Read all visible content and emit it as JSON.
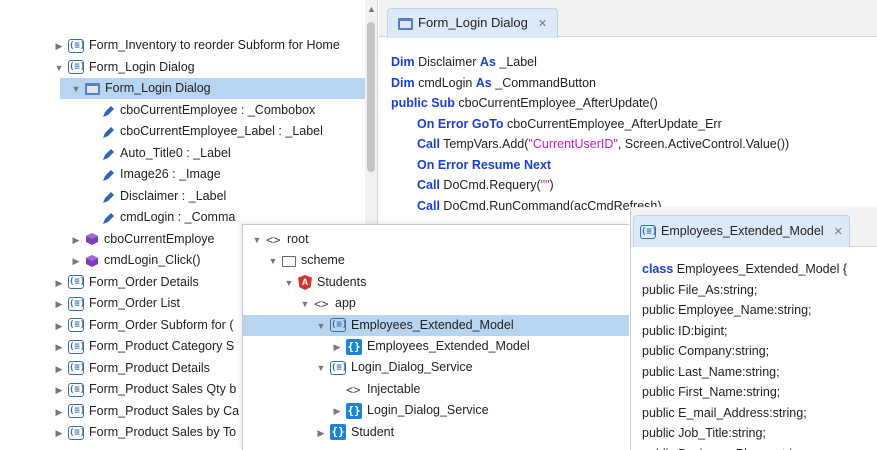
{
  "left_tree": {
    "rows": [
      {
        "label": "Form_Inventory to reorder Subform for Home",
        "icon": "module-icon",
        "expand": "▶",
        "level": 1
      },
      {
        "label": "Form_Login Dialog",
        "icon": "module-icon",
        "expand": "▼",
        "level": 1
      },
      {
        "label": "Form_Login Dialog",
        "icon": "form-icon",
        "expand": "▼",
        "level": 2,
        "selected": true
      },
      {
        "label": "cboCurrentEmployee : _Combobox",
        "icon": "field-icon",
        "expand": "",
        "level": 3
      },
      {
        "label": "cboCurrentEmployee_Label : _Label",
        "icon": "field-icon",
        "expand": "",
        "level": 3
      },
      {
        "label": "Auto_Title0 : _Label",
        "icon": "field-icon",
        "expand": "",
        "level": 3
      },
      {
        "label": "Image26 : _Image",
        "icon": "field-icon",
        "expand": "",
        "level": 3
      },
      {
        "label": "Disclaimer : _Label",
        "icon": "field-icon",
        "expand": "",
        "level": 3
      },
      {
        "label": "cmdLogin : _Comma",
        "icon": "field-icon",
        "expand": "",
        "level": 3
      },
      {
        "label": "cboCurrentEmploye",
        "icon": "method-icon",
        "expand": "▶",
        "level": 2
      },
      {
        "label": "cmdLogin_Click()",
        "icon": "method-icon",
        "expand": "▶",
        "level": 2
      },
      {
        "label": "Form_Order Details",
        "icon": "module-icon",
        "expand": "▶",
        "level": 1
      },
      {
        "label": "Form_Order List",
        "icon": "module-icon",
        "expand": "▶",
        "level": 1
      },
      {
        "label": "Form_Order Subform for (",
        "icon": "module-icon",
        "expand": "▶",
        "level": 1
      },
      {
        "label": "Form_Product Category S",
        "icon": "module-icon",
        "expand": "▶",
        "level": 1
      },
      {
        "label": "Form_Product Details",
        "icon": "module-icon",
        "expand": "▶",
        "level": 1
      },
      {
        "label": "Form_Product Sales Qty b",
        "icon": "module-icon",
        "expand": "▶",
        "level": 1
      },
      {
        "label": "Form_Product Sales by Ca",
        "icon": "module-icon",
        "expand": "▶",
        "level": 1
      },
      {
        "label": "Form_Product Sales by To",
        "icon": "module-icon",
        "expand": "▶",
        "level": 1
      }
    ]
  },
  "editor": {
    "tab_label": "Form_Login Dialog",
    "close_glyph": "✕",
    "lines": [
      {
        "indent": 0,
        "parts": [
          {
            "t": "Dim",
            "c": "kw"
          },
          {
            "t": " Disclaimer ",
            "c": "pl"
          },
          {
            "t": "As",
            "c": "kw"
          },
          {
            "t": " _Label",
            "c": "pl"
          }
        ]
      },
      {
        "indent": 0,
        "parts": [
          {
            "t": "Dim",
            "c": "kw"
          },
          {
            "t": " cmdLogin ",
            "c": "pl"
          },
          {
            "t": "As",
            "c": "kw"
          },
          {
            "t": " _CommandButton",
            "c": "pl"
          }
        ]
      },
      {
        "indent": 0,
        "parts": [
          {
            "t": "public Sub",
            "c": "kw"
          },
          {
            "t": " cboCurrentEmployee_AfterUpdate()",
            "c": "pl"
          }
        ]
      },
      {
        "indent": 1,
        "parts": [
          {
            "t": "On Error GoTo",
            "c": "kw"
          },
          {
            "t": " cboCurrentEmployee_AfterUpdate_Err",
            "c": "pl"
          }
        ]
      },
      {
        "indent": 1,
        "parts": [
          {
            "t": "Call",
            "c": "kw"
          },
          {
            "t": " TempVars.Add(",
            "c": "pl"
          },
          {
            "t": "\"CurrentUserID\"",
            "c": "str"
          },
          {
            "t": ", Screen.ActiveControl.Value())",
            "c": "pl"
          }
        ]
      },
      {
        "indent": 1,
        "parts": [
          {
            "t": "On Error Resume Next",
            "c": "kw"
          }
        ]
      },
      {
        "indent": 1,
        "parts": [
          {
            "t": "Call",
            "c": "kw"
          },
          {
            "t": " DoCmd.Requery(",
            "c": "pl"
          },
          {
            "t": "\"\"",
            "c": "str"
          },
          {
            "t": ")",
            "c": "pl"
          }
        ]
      },
      {
        "indent": 1,
        "parts": [
          {
            "t": "Call",
            "c": "kw"
          },
          {
            "t": " DoCmd.RunCommand(acCmdRefresh)",
            "c": "pl"
          }
        ]
      }
    ]
  },
  "float_tree": {
    "rows": [
      {
        "label": "root",
        "icon": "code-glyph",
        "expand": "▼",
        "level": 0
      },
      {
        "label": "scheme",
        "icon": "folder-icon",
        "expand": "▼",
        "level": 1
      },
      {
        "label": "Students",
        "icon": "angular-icon",
        "expand": "▼",
        "level": 2
      },
      {
        "label": "app",
        "icon": "code-glyph",
        "expand": "▼",
        "level": 3
      },
      {
        "label": "Employees_Extended_Model",
        "icon": "module-icon",
        "expand": "▼",
        "level": 4,
        "selected": true
      },
      {
        "label": "Employees_Extended_Model",
        "icon": "class-icon",
        "expand": "▶",
        "level": 5
      },
      {
        "label": "Login_Dialog_Service",
        "icon": "module-icon",
        "expand": "▼",
        "level": 4
      },
      {
        "label": "Injectable",
        "icon": "code-glyph",
        "expand": "",
        "level": 5
      },
      {
        "label": "Login_Dialog_Service",
        "icon": "class-icon",
        "expand": "▶",
        "level": 5
      },
      {
        "label": "Student",
        "icon": "class-icon",
        "expand": "▶",
        "level": 4
      }
    ]
  },
  "model_panel": {
    "tab_label": "Employees_Extended_Model",
    "close_glyph": "✕",
    "lines": [
      {
        "parts": [
          {
            "t": "class",
            "c": "kw"
          },
          {
            "t": " Employees_Extended_Model {",
            "c": "pl"
          }
        ]
      },
      {
        "parts": [
          {
            "t": "public File_As:string;",
            "c": "pl"
          }
        ]
      },
      {
        "parts": [
          {
            "t": "public Employee_Name:string;",
            "c": "pl"
          }
        ]
      },
      {
        "parts": [
          {
            "t": "public ID:bigint;",
            "c": "pl"
          }
        ]
      },
      {
        "parts": [
          {
            "t": "public Company:string;",
            "c": "pl"
          }
        ]
      },
      {
        "parts": [
          {
            "t": "public Last_Name:string;",
            "c": "pl"
          }
        ]
      },
      {
        "parts": [
          {
            "t": "public First_Name:string;",
            "c": "pl"
          }
        ]
      },
      {
        "parts": [
          {
            "t": "public E_mail_Address:string;",
            "c": "pl"
          }
        ]
      },
      {
        "parts": [
          {
            "t": "public Job_Title:string;",
            "c": "pl"
          }
        ]
      },
      {
        "parts": [
          {
            "t": "public Business_Phone:string;",
            "c": "pl"
          }
        ]
      }
    ]
  },
  "colors": {
    "selection": "#b7d4f0",
    "keyword": "#1b3fd6",
    "string": "#c71ac0",
    "tab_active": "#dbe9f8"
  }
}
